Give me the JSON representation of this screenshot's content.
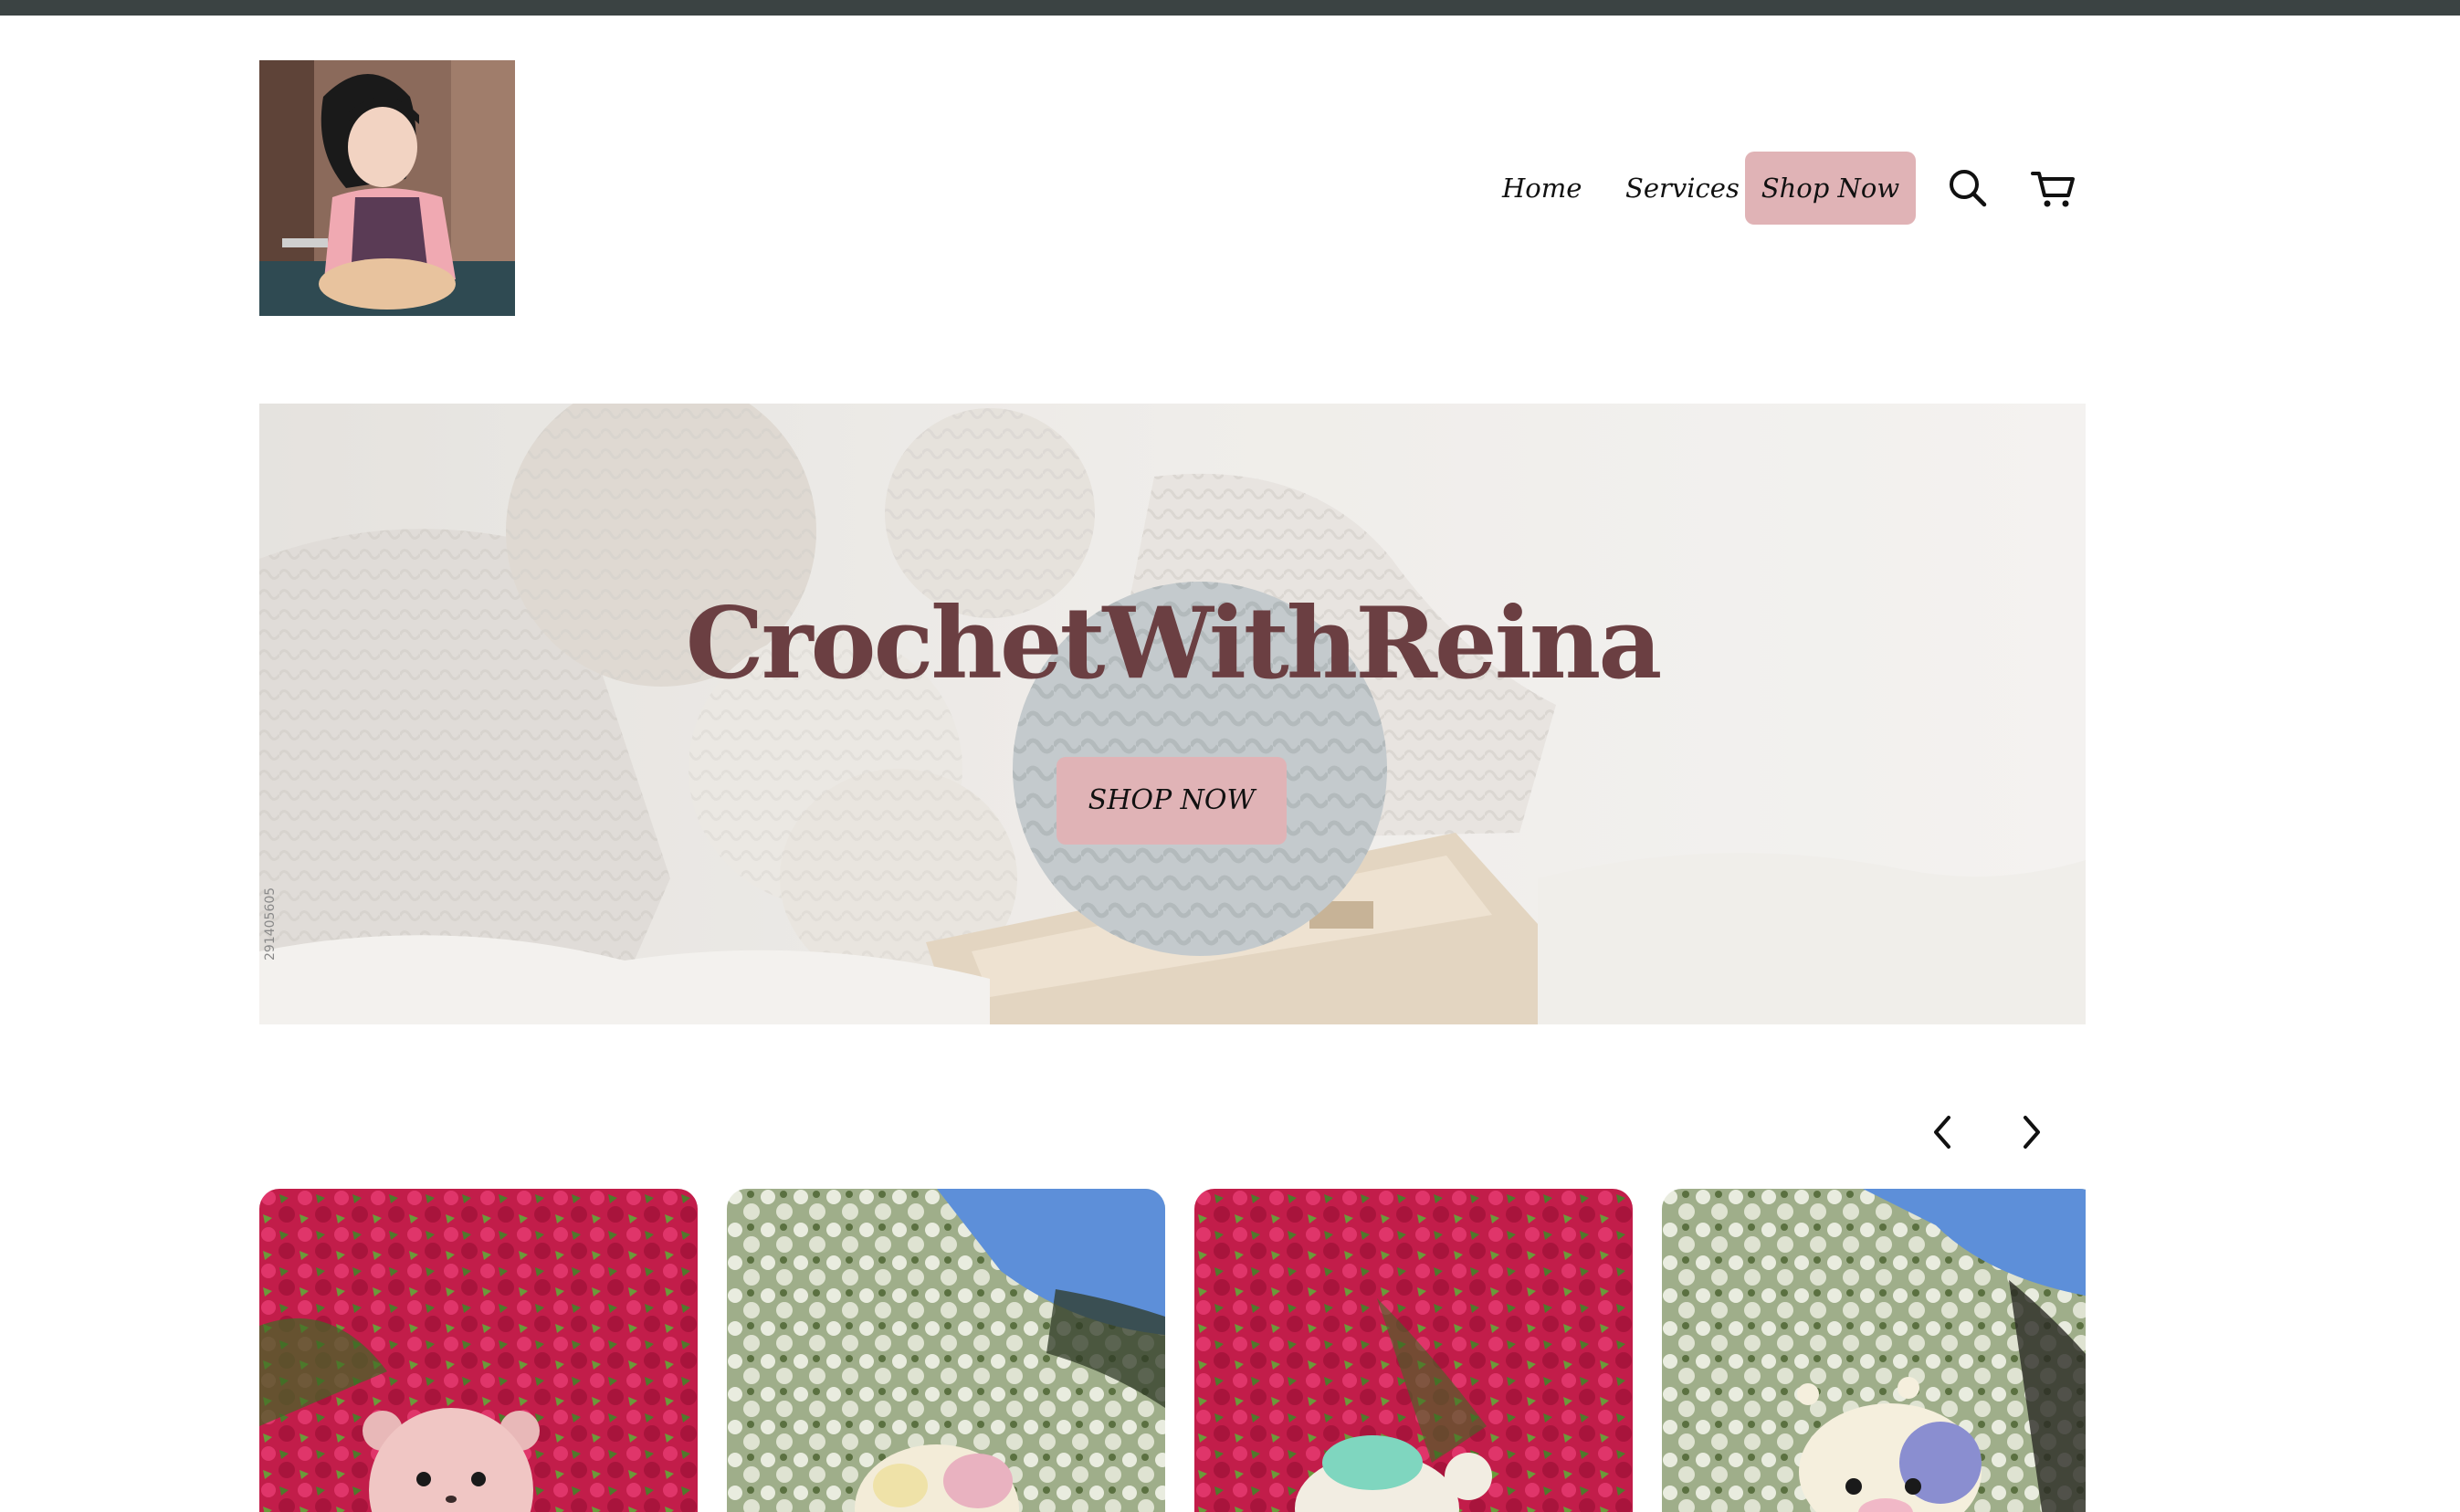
{
  "nav": {
    "home_label": "Home",
    "services_label": "Services",
    "shop_label": "Shop Now",
    "search_icon": "search-icon",
    "cart_icon": "cart-icon"
  },
  "hero": {
    "title": "CrochetWithReina",
    "cta_label": "SHOP NOW",
    "watermark_id": "291405605"
  },
  "carousel": {
    "prev_icon": "chevron-left-icon",
    "next_icon": "chevron-right-icon",
    "items": [
      {
        "name": "pink bear plush"
      },
      {
        "name": "strawberry cow plush"
      },
      {
        "name": "mint turtle plush"
      },
      {
        "name": "blue cow plush"
      }
    ]
  },
  "colors": {
    "accent": "#e0b3b6",
    "title": "#6b3f42",
    "topbar": "#3b4343"
  }
}
